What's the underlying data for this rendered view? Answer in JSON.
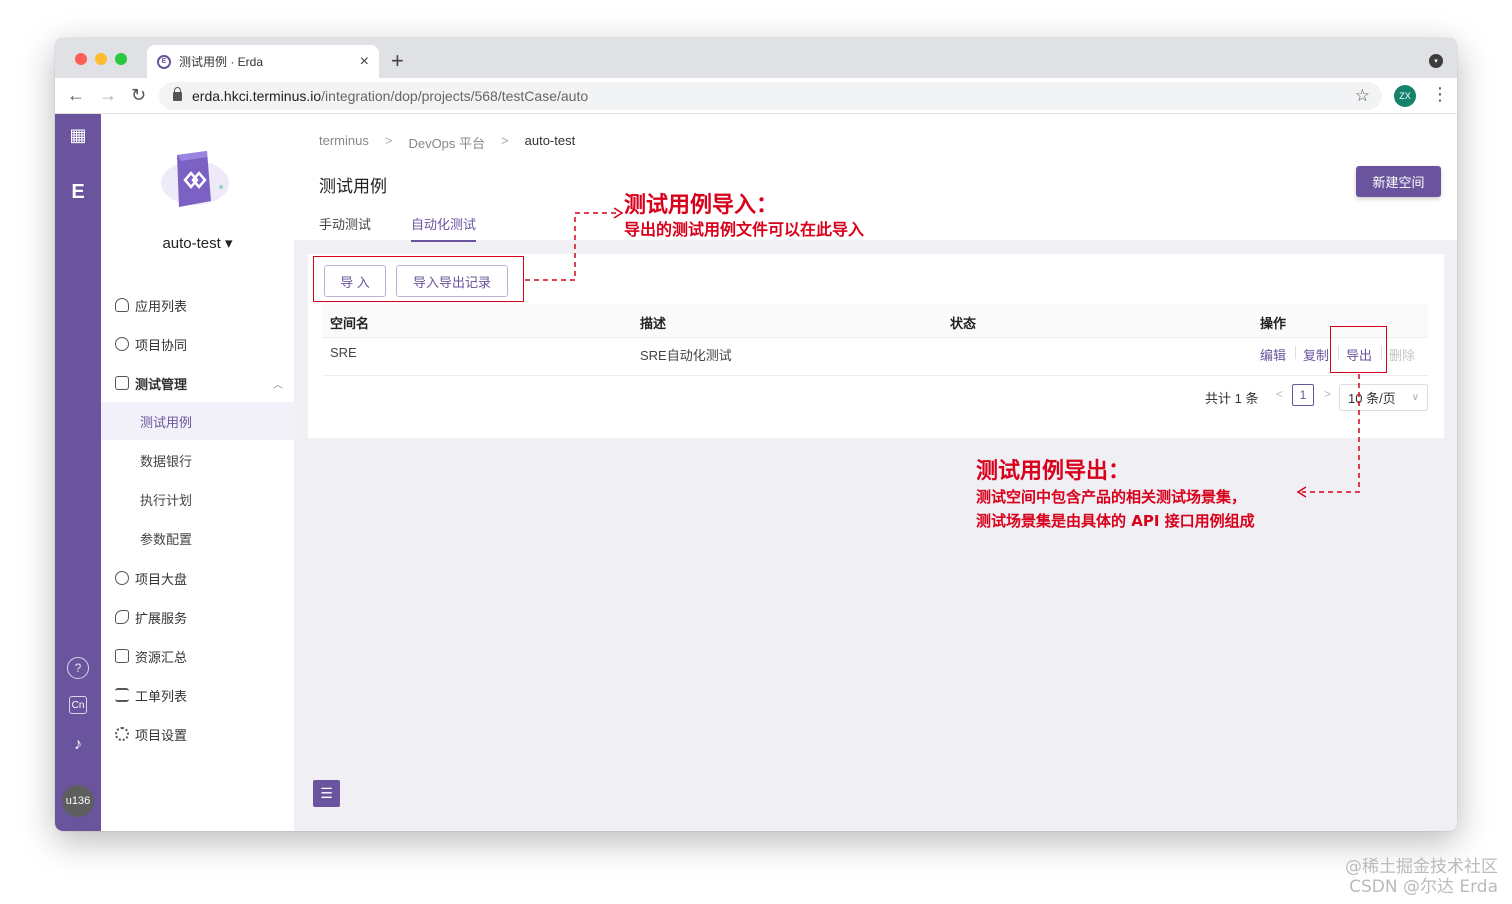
{
  "browser": {
    "tab_title": "测试用例 · Erda",
    "url_host": "erda.hkci.terminus.io",
    "url_path": "/integration/dop/projects/568/testCase/auto",
    "profile_initials": "ZX",
    "close_glyph": "×",
    "new_tab_glyph": "+",
    "back_glyph": "←",
    "forward_glyph": "→",
    "reload_glyph": "↻",
    "star_glyph": "☆",
    "menu_glyph": "⋮"
  },
  "leftbar": {
    "apps_glyph": "▦",
    "brand_glyph": "E",
    "help_glyph": "?",
    "lang_glyph": "Cn",
    "bell_glyph": "♪",
    "user_label": "u136"
  },
  "sidebar": {
    "project_name": "auto-test ▾",
    "items": [
      {
        "label": "应用列表"
      },
      {
        "label": "项目协同"
      },
      {
        "label": "测试管理"
      },
      {
        "label": "项目大盘"
      },
      {
        "label": "扩展服务"
      },
      {
        "label": "资源汇总"
      },
      {
        "label": "工单列表"
      },
      {
        "label": "项目设置"
      }
    ],
    "subitems": [
      {
        "label": "测试用例"
      },
      {
        "label": "数据银行"
      },
      {
        "label": "执行计划"
      },
      {
        "label": "参数配置"
      }
    ],
    "collapse_glyph": "☰",
    "expand_glyph": "︿"
  },
  "breadcrumb": {
    "items": [
      "terminus",
      "DevOps 平台",
      "auto-test"
    ],
    "sep": ">"
  },
  "page": {
    "title": "测试用例",
    "new_space_button": "新建空间",
    "tabs": [
      "手动测试",
      "自动化测试"
    ]
  },
  "toolbar": {
    "import_button": "导 入",
    "records_button": "导入导出记录"
  },
  "table": {
    "headers": [
      "空间名",
      "描述",
      "状态",
      "操作"
    ],
    "rows": [
      {
        "name": "SRE",
        "description": "SRE自动化测试",
        "status": "",
        "actions": [
          "编辑",
          "复制",
          "导出",
          "删除"
        ]
      }
    ]
  },
  "pagination": {
    "total": "共计 1 条",
    "current_page": "1",
    "page_size": "10 条/页",
    "prev_glyph": "<",
    "next_glyph": ">",
    "chevron_glyph": "∨"
  },
  "annotations": {
    "import_title": "测试用例导入：",
    "import_desc": "导出的测试用例文件可以在此导入",
    "export_title": "测试用例导出：",
    "export_desc_1": "测试空间中包含产品的相关测试场景集，",
    "export_desc_2": "测试场景集是由具体的 API 接口用例组成",
    "color": "#d9001b"
  },
  "watermark": {
    "line1": "@稀土掘金技术社区",
    "line2": "CSDN @尔达 Erda"
  },
  "colors": {
    "brand": "#6a549e",
    "annotation": "#d9001b"
  }
}
